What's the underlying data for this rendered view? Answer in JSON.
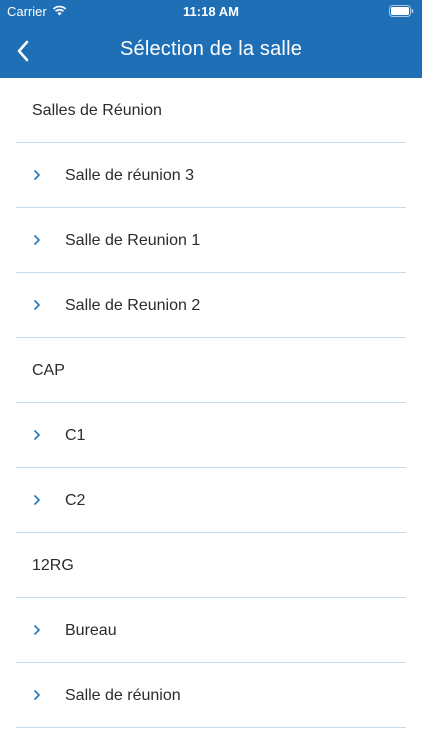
{
  "status_bar": {
    "carrier": "Carrier",
    "time": "11:18 AM",
    "wifi_icon": "wifi-icon",
    "battery_icon": "battery-icon"
  },
  "nav": {
    "title": "Sélection de la salle",
    "back_icon": "chevron-left-icon"
  },
  "colors": {
    "header_bg": "#1e6fb6",
    "accent": "#2b7fc0",
    "divider": "#c5d9ec",
    "text": "#2b2b2b"
  },
  "groups": [
    {
      "label": "Salles de Réunion",
      "items": [
        "Salle de réunion 3",
        "Salle de Reunion 1",
        "Salle de Reunion 2"
      ]
    },
    {
      "label": "CAP",
      "items": [
        "C1",
        "C2"
      ]
    },
    {
      "label": "12RG",
      "items": [
        "Bureau",
        "Salle de réunion"
      ]
    }
  ]
}
